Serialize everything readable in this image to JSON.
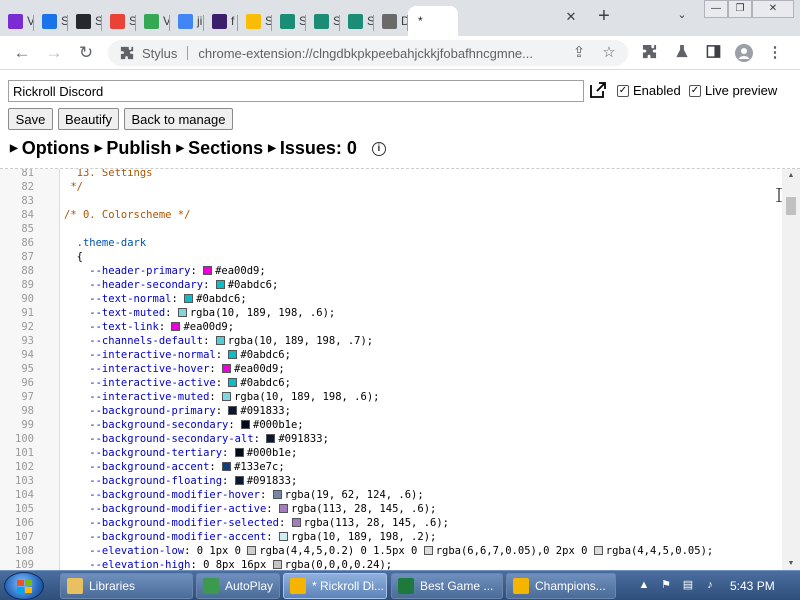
{
  "browser": {
    "tabs": [
      {
        "favicon": "feather-icon",
        "color": "#7a2bd1",
        "label": "V"
      },
      {
        "favicon": "gear-icon",
        "color": "#1a73e8",
        "label": "S"
      },
      {
        "favicon": "github-icon",
        "color": "#24292e",
        "label": "S"
      },
      {
        "favicon": "rainbow-icon",
        "color": "#ea4335",
        "label": "S"
      },
      {
        "favicon": "grid-icon",
        "color": "#34a853",
        "label": "V"
      },
      {
        "favicon": "google-icon",
        "color": "#4285f4",
        "label": "ji"
      },
      {
        "favicon": "square-icon",
        "color": "#3b1f6b",
        "label": "f"
      },
      {
        "favicon": "grid-icon",
        "color": "#fbbc05",
        "label": "S"
      },
      {
        "favicon": "s-icon",
        "color": "#1b8c76",
        "label": "S"
      },
      {
        "favicon": "s-icon",
        "color": "#1b8c76",
        "label": "S"
      },
      {
        "favicon": "s-icon",
        "color": "#1b8c76",
        "label": "S"
      },
      {
        "favicon": "roblox-icon",
        "color": "#6a6a6a",
        "label": "D"
      }
    ],
    "active_tab": {
      "title": "*"
    },
    "site_label": "Stylus",
    "url": "chrome-extension://clngdbkpkpeebahjckkjfobafhncgmne..."
  },
  "editor_header": {
    "style_name": "Rickroll Discord",
    "enabled_label": "Enabled",
    "live_preview_label": "Live preview",
    "buttons": {
      "save": "Save",
      "beautify": "Beautify",
      "back": "Back to manage"
    },
    "sections": {
      "options": "Options",
      "publish": "Publish",
      "sections": "Sections",
      "issues": "Issues: 0"
    }
  },
  "code_lines": [
    {
      "n": "81",
      "parts": [
        {
          "t": "cm",
          "v": "  13. Settings"
        }
      ]
    },
    {
      "n": "82",
      "parts": [
        {
          "t": "cm",
          "v": " */"
        }
      ]
    },
    {
      "n": "83",
      "parts": []
    },
    {
      "n": "84",
      "parts": [
        {
          "t": "cm",
          "v": "/* 0. Colorscheme */"
        }
      ]
    },
    {
      "n": "85",
      "parts": []
    },
    {
      "n": "86",
      "parts": [
        {
          "t": "sel",
          "v": "  .theme-dark"
        }
      ]
    },
    {
      "n": "87",
      "parts": [
        {
          "t": "txt",
          "v": "  {"
        }
      ]
    },
    {
      "n": "88",
      "parts": [
        {
          "t": "prop",
          "v": "    --header-primary"
        },
        {
          "t": "txt",
          "v": ": "
        },
        {
          "t": "sw",
          "c": "#ea00d9"
        },
        {
          "t": "txt",
          "v": "#ea00d9;"
        }
      ]
    },
    {
      "n": "89",
      "parts": [
        {
          "t": "prop",
          "v": "    --header-secondary"
        },
        {
          "t": "txt",
          "v": ": "
        },
        {
          "t": "sw",
          "c": "#0abdc6"
        },
        {
          "t": "txt",
          "v": "#0abdc6;"
        }
      ]
    },
    {
      "n": "90",
      "parts": [
        {
          "t": "prop",
          "v": "    --text-normal"
        },
        {
          "t": "txt",
          "v": ": "
        },
        {
          "t": "sw",
          "c": "#0abdc6"
        },
        {
          "t": "txt",
          "v": "#0abdc6;"
        }
      ]
    },
    {
      "n": "91",
      "parts": [
        {
          "t": "prop",
          "v": "    --text-muted"
        },
        {
          "t": "txt",
          "v": ": "
        },
        {
          "t": "sw",
          "c": "#7fd6dc"
        },
        {
          "t": "txt",
          "v": "rgba(10, 189, 198, .6);"
        }
      ]
    },
    {
      "n": "92",
      "parts": [
        {
          "t": "prop",
          "v": "    --text-link"
        },
        {
          "t": "txt",
          "v": ": "
        },
        {
          "t": "sw",
          "c": "#ea00d9"
        },
        {
          "t": "txt",
          "v": "#ea00d9;"
        }
      ]
    },
    {
      "n": "93",
      "parts": [
        {
          "t": "prop",
          "v": "    --channels-default"
        },
        {
          "t": "txt",
          "v": ": "
        },
        {
          "t": "sw",
          "c": "#54ccd3"
        },
        {
          "t": "txt",
          "v": "rgba(10, 189, 198, .7);"
        }
      ]
    },
    {
      "n": "94",
      "parts": [
        {
          "t": "prop",
          "v": "    --interactive-normal"
        },
        {
          "t": "txt",
          "v": ": "
        },
        {
          "t": "sw",
          "c": "#0abdc6"
        },
        {
          "t": "txt",
          "v": "#0abdc6;"
        }
      ]
    },
    {
      "n": "95",
      "parts": [
        {
          "t": "prop",
          "v": "    --interactive-hover"
        },
        {
          "t": "txt",
          "v": ": "
        },
        {
          "t": "sw",
          "c": "#ea00d9"
        },
        {
          "t": "txt",
          "v": "#ea00d9;"
        }
      ]
    },
    {
      "n": "96",
      "parts": [
        {
          "t": "prop",
          "v": "    --interactive-active"
        },
        {
          "t": "txt",
          "v": ": "
        },
        {
          "t": "sw",
          "c": "#0abdc6"
        },
        {
          "t": "txt",
          "v": "#0abdc6;"
        }
      ]
    },
    {
      "n": "97",
      "parts": [
        {
          "t": "prop",
          "v": "    --interactive-muted"
        },
        {
          "t": "txt",
          "v": ": "
        },
        {
          "t": "sw",
          "c": "#7fd6dc"
        },
        {
          "t": "txt",
          "v": "rgba(10, 189, 198, .6);"
        }
      ]
    },
    {
      "n": "98",
      "parts": [
        {
          "t": "prop",
          "v": "    --background-primary"
        },
        {
          "t": "txt",
          "v": ": "
        },
        {
          "t": "sw",
          "c": "#091833"
        },
        {
          "t": "txt",
          "v": "#091833;"
        }
      ]
    },
    {
      "n": "99",
      "parts": [
        {
          "t": "prop",
          "v": "    --background-secondary"
        },
        {
          "t": "txt",
          "v": ": "
        },
        {
          "t": "sw",
          "c": "#000b1e"
        },
        {
          "t": "txt",
          "v": "#000b1e;"
        }
      ]
    },
    {
      "n": "100",
      "parts": [
        {
          "t": "prop",
          "v": "    --background-secondary-alt"
        },
        {
          "t": "txt",
          "v": ": "
        },
        {
          "t": "sw",
          "c": "#091833"
        },
        {
          "t": "txt",
          "v": "#091833;"
        }
      ]
    },
    {
      "n": "101",
      "parts": [
        {
          "t": "prop",
          "v": "    --background-tertiary"
        },
        {
          "t": "txt",
          "v": ": "
        },
        {
          "t": "sw",
          "c": "#000b1e"
        },
        {
          "t": "txt",
          "v": "#000b1e;"
        }
      ]
    },
    {
      "n": "102",
      "parts": [
        {
          "t": "prop",
          "v": "    --background-accent"
        },
        {
          "t": "txt",
          "v": ": "
        },
        {
          "t": "sw",
          "c": "#133e7c"
        },
        {
          "t": "txt",
          "v": "#133e7c;"
        }
      ]
    },
    {
      "n": "103",
      "parts": [
        {
          "t": "prop",
          "v": "    --background-floating"
        },
        {
          "t": "txt",
          "v": ": "
        },
        {
          "t": "sw",
          "c": "#091833"
        },
        {
          "t": "txt",
          "v": "#091833;"
        }
      ]
    },
    {
      "n": "104",
      "parts": [
        {
          "t": "prop",
          "v": "    --background-modifier-hover"
        },
        {
          "t": "txt",
          "v": ": "
        },
        {
          "t": "sw",
          "c": "#7687a5"
        },
        {
          "t": "txt",
          "v": "rgba(19, 62, 124, .6);"
        }
      ]
    },
    {
      "n": "105",
      "parts": [
        {
          "t": "prop",
          "v": "    --background-modifier-active"
        },
        {
          "t": "txt",
          "v": ": "
        },
        {
          "t": "sw",
          "c": "#a47bbd"
        },
        {
          "t": "txt",
          "v": "rgba(113, 28, 145, .6);"
        }
      ]
    },
    {
      "n": "106",
      "parts": [
        {
          "t": "prop",
          "v": "    --background-modifier-selected"
        },
        {
          "t": "txt",
          "v": ": "
        },
        {
          "t": "sw",
          "c": "#a47bbd"
        },
        {
          "t": "txt",
          "v": "rgba(113, 28, 145, .6);"
        }
      ]
    },
    {
      "n": "107",
      "parts": [
        {
          "t": "prop",
          "v": "    --background-modifier-accent"
        },
        {
          "t": "txt",
          "v": ": "
        },
        {
          "t": "sw",
          "c": "#cdeff1"
        },
        {
          "t": "txt",
          "v": "rgba(10, 189, 198, .2);"
        }
      ]
    },
    {
      "n": "108",
      "parts": [
        {
          "t": "prop",
          "v": "    --elevation-low"
        },
        {
          "t": "txt",
          "v": ": 0 1px 0 "
        },
        {
          "t": "sw",
          "c": "#cfcfcf"
        },
        {
          "t": "txt",
          "v": "rgba(4,4,5,0.2) 0 1.5px 0 "
        },
        {
          "t": "sw",
          "c": "#dcdcdc"
        },
        {
          "t": "txt",
          "v": "rgba(6,6,7,0.05),0 2px 0 "
        },
        {
          "t": "sw",
          "c": "#dcdcdc"
        },
        {
          "t": "txt",
          "v": "rgba(4,4,5,0.05);"
        }
      ]
    },
    {
      "n": "109",
      "parts": [
        {
          "t": "prop",
          "v": "    --elevation-high"
        },
        {
          "t": "txt",
          "v": ": 0 8px 16px "
        },
        {
          "t": "sw",
          "c": "#c4c4c4"
        },
        {
          "t": "txt",
          "v": "rgba(0,0,0,0.24);"
        }
      ]
    }
  ],
  "taskbar": {
    "items": [
      {
        "icon": "folder-icon",
        "color": "#e8c060",
        "label": "Libraries"
      },
      {
        "icon": "autoplay-icon",
        "color": "#3c9a4c",
        "label": "AutoPlay"
      },
      {
        "icon": "chrome-icon",
        "color": "#f4b400",
        "label": "* Rickroll Di..."
      },
      {
        "icon": "excel-icon",
        "color": "#1d7a3c",
        "label": "Best Game ..."
      },
      {
        "icon": "chrome-icon",
        "color": "#f4b400",
        "label": "Champions..."
      }
    ],
    "clock": "5:43 PM"
  }
}
